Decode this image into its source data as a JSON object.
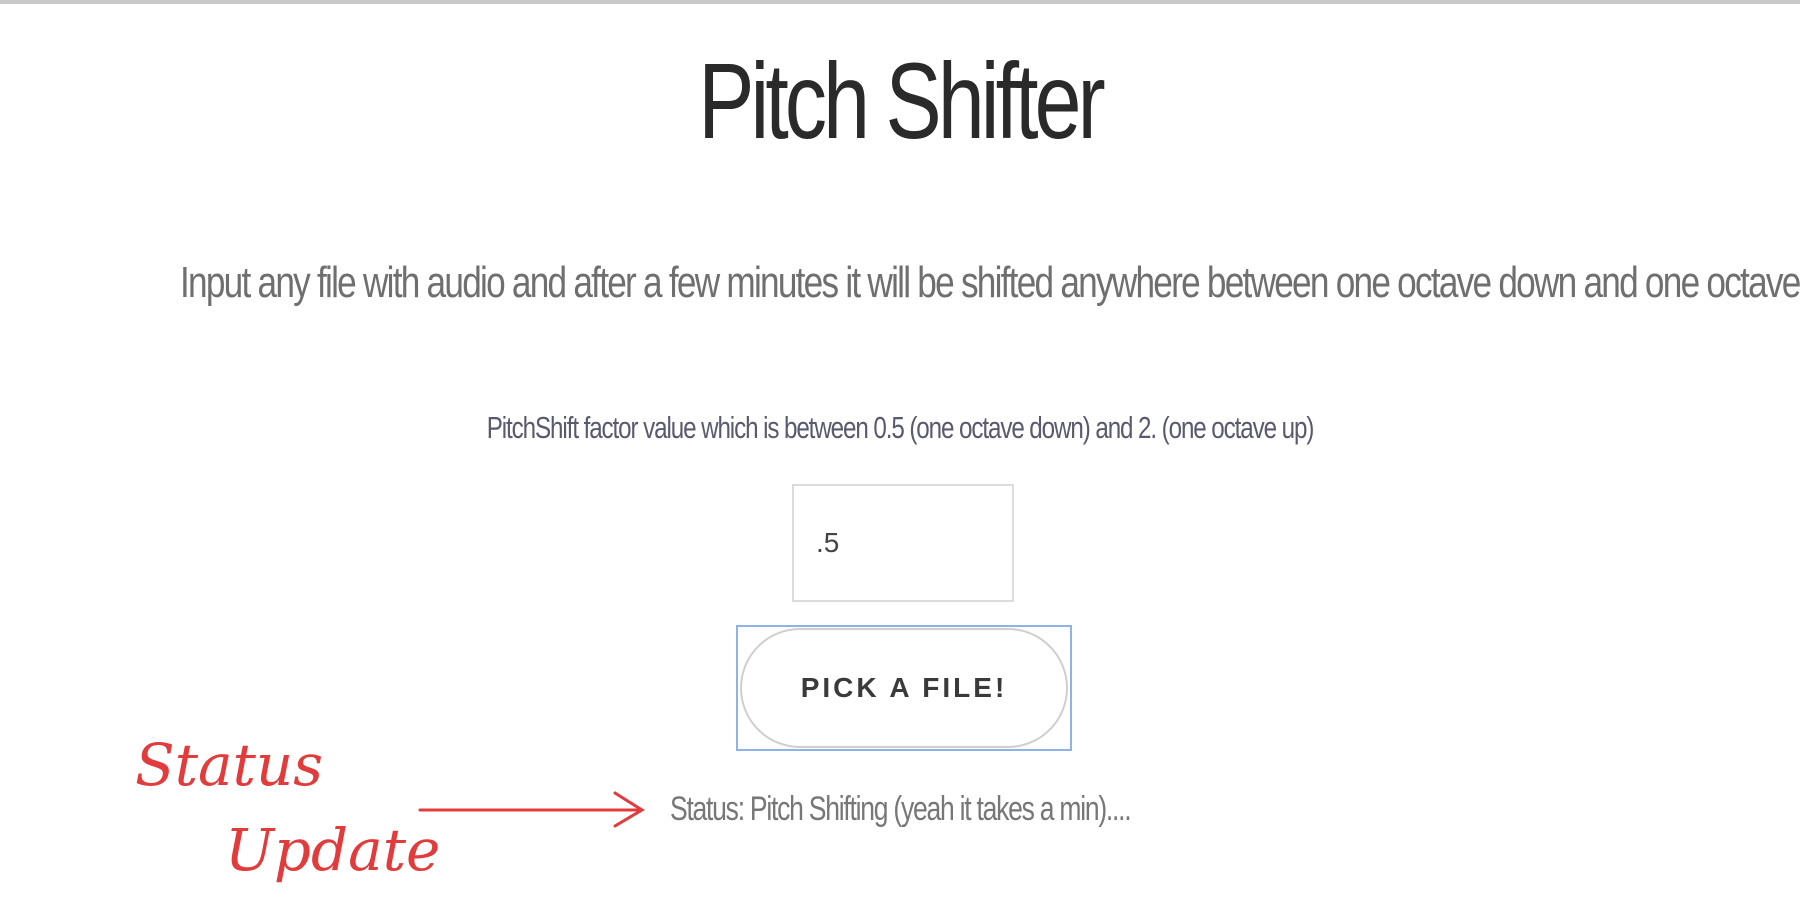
{
  "page": {
    "title": "Pitch Shifter",
    "subtitle": "Input any file with audio and after a few minutes it will be shifted anywhere between one octave down and one octave up."
  },
  "form": {
    "factor_label": "PitchShift factor value which is between 0.5 (one octave down) and 2. (one octave up)",
    "factor_value": ".5",
    "pick_button_label": "PICK A FILE!"
  },
  "status": {
    "text": "Status: Pitch Shifting (yeah it takes a min)...."
  },
  "annotation": {
    "line1": "Status",
    "line2": "Update",
    "color": "#e23b3b"
  },
  "colors": {
    "focus_ring": "#8fb2e8",
    "title_text": "#2a2a2a"
  }
}
